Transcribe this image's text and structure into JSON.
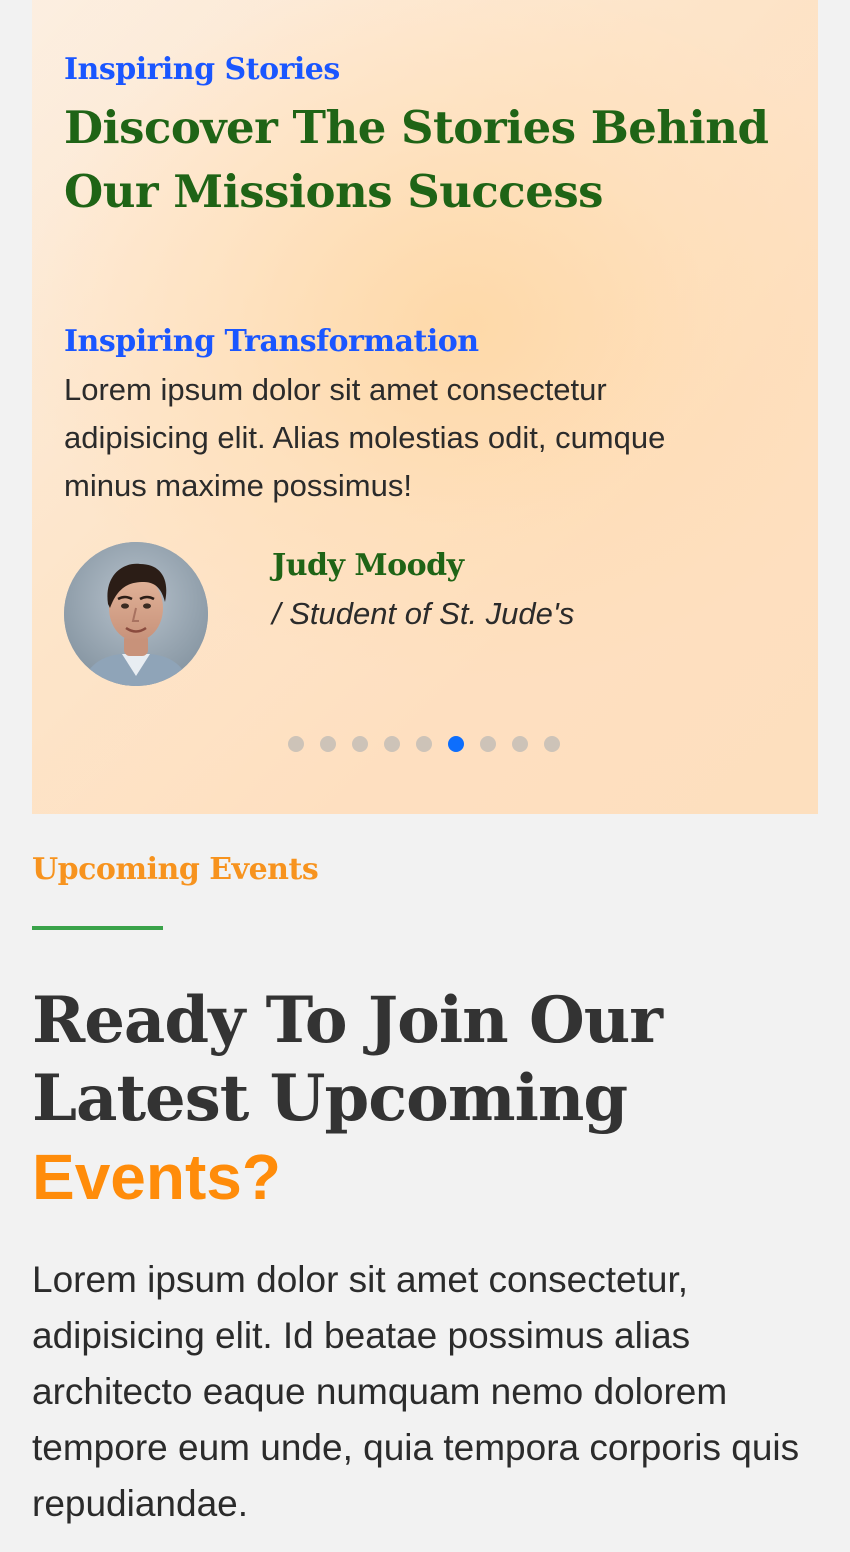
{
  "testimonials": {
    "eyebrow": "Inspiring Stories",
    "title": "Discover The Stories Behind Our Missions Success",
    "slide": {
      "heading": "Inspiring Transformation",
      "text": "Lorem ipsum dolor sit amet consectetur adipisicing elit. Alias molestias odit, cumque minus maxime possimus!",
      "author_name": "Judy Moody",
      "author_role": "/ Student of St. Jude's"
    },
    "carousel": {
      "total_slides": 9,
      "active_index": 5
    }
  },
  "events": {
    "eyebrow": "Upcoming Events",
    "title_main": "Ready To Join Our Latest Upcoming",
    "title_accent": "Events?",
    "text": "Lorem ipsum dolor sit amet consectetur, adipisicing elit. Id beatae possimus alias architecto eaque numquam nemo dolorem tempore eum unde, quia tempora corporis quis repudiandae."
  },
  "colors": {
    "link_blue": "#1a56ff",
    "brand_green": "#1f6416",
    "accent_orange": "#ff8c0a",
    "dot_active": "#0d6efd",
    "rule_green": "#3aa34a"
  }
}
